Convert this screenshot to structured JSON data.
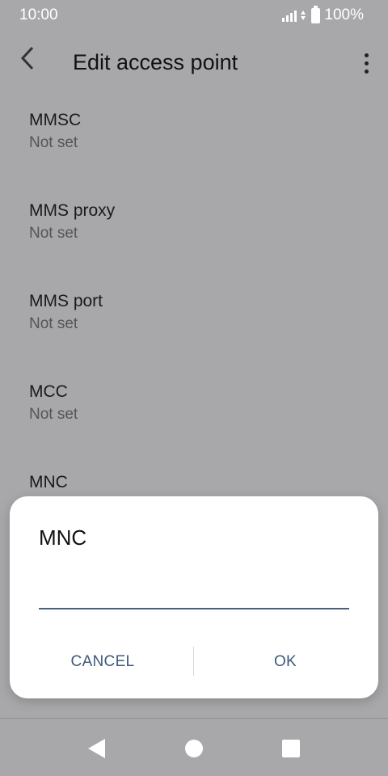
{
  "status": {
    "time": "10:00",
    "battery": "100%"
  },
  "app_bar": {
    "title": "Edit access point"
  },
  "settings": [
    {
      "title": "MMSC",
      "value": "Not set"
    },
    {
      "title": "MMS proxy",
      "value": "Not set"
    },
    {
      "title": "MMS port",
      "value": "Not set"
    },
    {
      "title": "MCC",
      "value": "Not set"
    },
    {
      "title": "MNC",
      "value": ""
    }
  ],
  "dialog": {
    "title": "MNC",
    "input_value": "",
    "cancel_label": "CANCEL",
    "ok_label": "OK"
  },
  "colors": {
    "scrim_background": "#a8a8aa",
    "accent": "#3f5a7d",
    "input_underline": "#4a5f7a"
  },
  "icons": [
    "back-arrow-icon",
    "overflow-menu-icon",
    "signal-icon",
    "data-arrows-icon",
    "battery-icon",
    "nav-back-icon",
    "nav-home-icon",
    "nav-recents-icon"
  ]
}
